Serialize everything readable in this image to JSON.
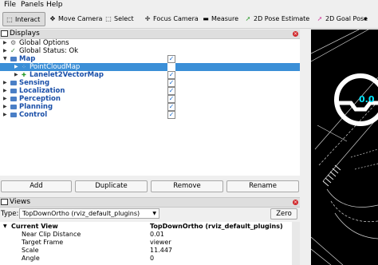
{
  "menu": {
    "file": "File",
    "panels": "Panels",
    "help": "Help"
  },
  "toolbar": {
    "interact": "Interact",
    "move_camera": "Move Camera",
    "select": "Select",
    "focus_camera": "Focus Camera",
    "measure": "Measure",
    "pose_estimate": "2D Pose Estimate",
    "goal_pose": "2D Goal Pose"
  },
  "displays": {
    "title": "Displays",
    "items": [
      {
        "label": "Global Options"
      },
      {
        "label": "Global Status: Ok"
      },
      {
        "label": "Map",
        "checked": true
      },
      {
        "label": "PointCloudMap",
        "checked": false,
        "selected": true
      },
      {
        "label": "Lanelet2VectorMap",
        "checked": true
      },
      {
        "label": "Sensing",
        "checked": true
      },
      {
        "label": "Localization",
        "checked": true
      },
      {
        "label": "Perception",
        "checked": true
      },
      {
        "label": "Planning",
        "checked": true
      },
      {
        "label": "Control",
        "checked": true
      }
    ],
    "buttons": {
      "add": "Add",
      "duplicate": "Duplicate",
      "remove": "Remove",
      "rename": "Rename"
    }
  },
  "views": {
    "title": "Views",
    "type_label": "Type:",
    "type_value": "TopDownOrtho (rviz_default_plugins)",
    "zero": "Zero",
    "properties": [
      {
        "name": "Current View",
        "value": "TopDownOrtho (rviz_default_plugins)"
      },
      {
        "name": "Near Clip Distance",
        "value": "0.01"
      },
      {
        "name": "Target Frame",
        "value": "viewer"
      },
      {
        "name": "Scale",
        "value": "11.447"
      },
      {
        "name": "Angle",
        "value": "0"
      }
    ]
  },
  "viewport": {
    "overlay_text": "0.0"
  },
  "colors": {
    "selection": "#3b8fd7",
    "category_text": "#1a4fa8",
    "close": "#d0282c",
    "overlay": "#00e5ff"
  }
}
